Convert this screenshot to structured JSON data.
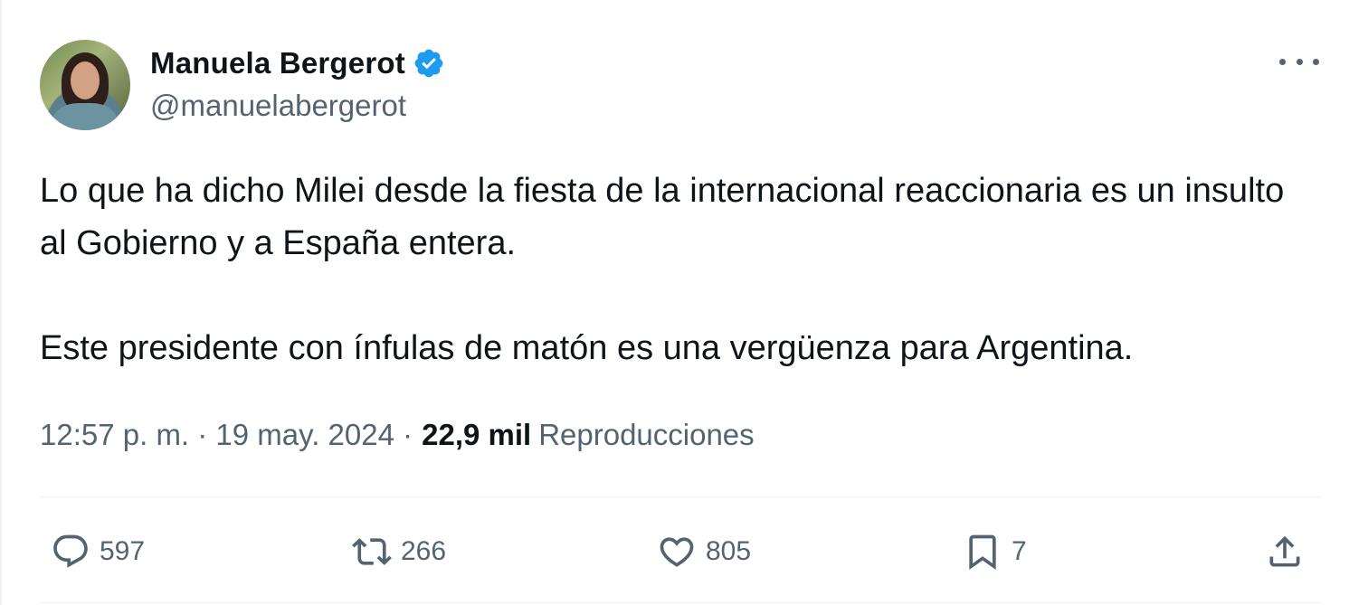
{
  "author": {
    "name": "Manuela Bergerot",
    "handle": "@manuelabergerot",
    "verified": true,
    "verified_color": "#1d9bf0"
  },
  "tweet": {
    "paragraphs": [
      "Lo que ha dicho Milei desde la fiesta de la internacional reaccionaria es un insulto al Gobierno y a España entera.",
      "Este presidente con ínfulas de matón es una vergüenza para Argentina."
    ],
    "time_date": "12:57 p. m. · 19 may. 2024 ·",
    "views_count": "22,9 mil",
    "views_label": "Reproducciones"
  },
  "actions": {
    "reply": {
      "icon": "reply-icon",
      "count": "597"
    },
    "retweet": {
      "icon": "retweet-icon",
      "count": "266"
    },
    "like": {
      "icon": "heart-icon",
      "count": "805"
    },
    "bookmark": {
      "icon": "bookmark-icon",
      "count": "7"
    },
    "share": {
      "icon": "share-icon"
    }
  },
  "colors": {
    "text": "#0f1419",
    "secondary": "#536471",
    "divider": "#eff3f4"
  }
}
